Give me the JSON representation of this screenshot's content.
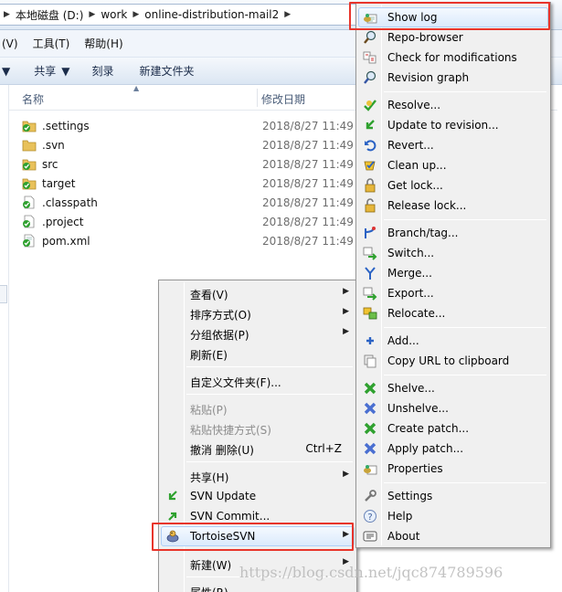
{
  "address_bar": {
    "crumbs": [
      "本地磁盘 (D:)",
      "work",
      "online-distribution-mail2"
    ]
  },
  "menubar": {
    "items": [
      "(V)",
      "工具(T)",
      "帮助(H)"
    ]
  },
  "toolbar": {
    "items": [
      "共享",
      "刻录",
      "新建文件夹"
    ]
  },
  "file_list": {
    "columns": {
      "name": "名称",
      "modified": "修改日期"
    },
    "rows": [
      {
        "name": ".settings",
        "date": "2018/8/27 11:49",
        "kind": "folder-ok"
      },
      {
        "name": ".svn",
        "date": "2018/8/27 11:49",
        "kind": "folder"
      },
      {
        "name": "src",
        "date": "2018/8/27 11:49",
        "kind": "folder-ok"
      },
      {
        "name": "target",
        "date": "2018/8/27 11:49",
        "kind": "folder-ok"
      },
      {
        "name": ".classpath",
        "date": "2018/8/27 11:49",
        "kind": "file-ok"
      },
      {
        "name": ".project",
        "date": "2018/8/27 11:49",
        "kind": "file-ok"
      },
      {
        "name": "pom.xml",
        "date": "2018/8/27 11:49",
        "kind": "file-ok"
      }
    ]
  },
  "context_menu": {
    "items": [
      {
        "label": "查看(V)",
        "submenu": true
      },
      {
        "label": "排序方式(O)",
        "submenu": true
      },
      {
        "label": "分组依据(P)",
        "submenu": true
      },
      {
        "label": "刷新(E)"
      },
      {
        "label": "自定义文件夹(F)..."
      },
      {
        "label": "粘贴(P)",
        "disabled": true
      },
      {
        "label": "粘贴快捷方式(S)",
        "disabled": true
      },
      {
        "label": "撤消 删除(U)",
        "shortcut": "Ctrl+Z"
      },
      {
        "label": "共享(H)",
        "submenu": true
      },
      {
        "label": "SVN Update",
        "icon": "svn-update-icon"
      },
      {
        "label": "SVN Commit...",
        "icon": "svn-commit-icon"
      },
      {
        "label": "TortoiseSVN",
        "icon": "tortoisesvn-icon",
        "submenu": true
      },
      {
        "label": "新建(W)",
        "submenu": true
      },
      {
        "label": "属性(R)"
      }
    ]
  },
  "svn_menu": {
    "items": [
      {
        "label": "Show log",
        "icon": "show-log-icon"
      },
      {
        "label": "Repo-browser",
        "icon": "repo-browser-icon"
      },
      {
        "label": "Check for modifications",
        "icon": "check-modifications-icon"
      },
      {
        "label": "Revision graph",
        "icon": "revision-graph-icon"
      },
      {
        "label": "Resolve...",
        "icon": "resolve-icon"
      },
      {
        "label": "Update to revision...",
        "icon": "update-revision-icon"
      },
      {
        "label": "Revert...",
        "icon": "revert-icon"
      },
      {
        "label": "Clean up...",
        "icon": "cleanup-icon"
      },
      {
        "label": "Get lock...",
        "icon": "get-lock-icon"
      },
      {
        "label": "Release lock...",
        "icon": "release-lock-icon"
      },
      {
        "label": "Branch/tag...",
        "icon": "branch-tag-icon"
      },
      {
        "label": "Switch...",
        "icon": "switch-icon"
      },
      {
        "label": "Merge...",
        "icon": "merge-icon"
      },
      {
        "label": "Export...",
        "icon": "export-icon"
      },
      {
        "label": "Relocate...",
        "icon": "relocate-icon"
      },
      {
        "label": "Add...",
        "icon": "add-icon"
      },
      {
        "label": "Copy URL to clipboard",
        "icon": "copy-url-icon"
      },
      {
        "label": "Shelve...",
        "icon": "shelve-icon"
      },
      {
        "label": "Unshelve...",
        "icon": "unshelve-icon"
      },
      {
        "label": "Create patch...",
        "icon": "create-patch-icon"
      },
      {
        "label": "Apply patch...",
        "icon": "apply-patch-icon"
      },
      {
        "label": "Properties",
        "icon": "properties-icon"
      },
      {
        "label": "Settings",
        "icon": "settings-icon"
      },
      {
        "label": "Help",
        "icon": "help-icon"
      },
      {
        "label": "About",
        "icon": "about-icon"
      }
    ]
  },
  "watermark": "https://blog.csdn.net/jqc874789596",
  "colors": {
    "highlight_border": "#e8352b",
    "svn_green": "#2fa12f"
  }
}
